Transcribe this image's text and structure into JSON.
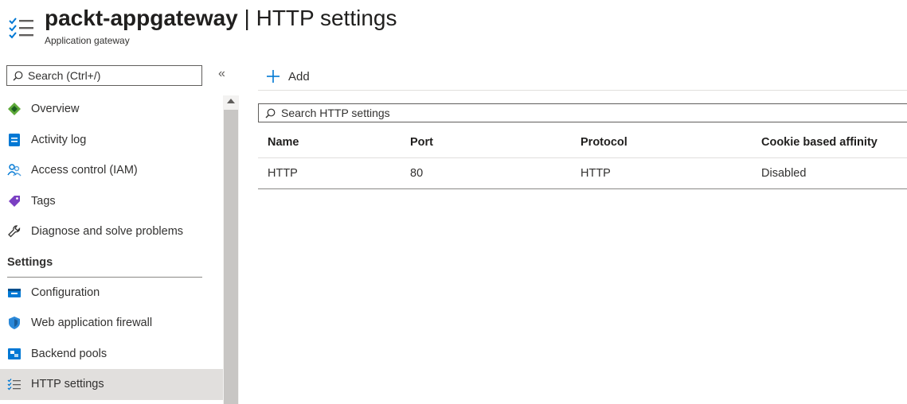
{
  "header": {
    "resource_name": "packt-appgateway",
    "separator": " | ",
    "page_name": "HTTP settings",
    "subtitle": "Application gateway",
    "icon": "http-settings-icon"
  },
  "sidebar": {
    "search_placeholder": "Search (Ctrl+/)",
    "collapse_label": "«",
    "items_top": [
      {
        "label": "Overview",
        "icon": "overview-icon"
      },
      {
        "label": "Activity log",
        "icon": "activity-log-icon"
      },
      {
        "label": "Access control (IAM)",
        "icon": "iam-icon"
      },
      {
        "label": "Tags",
        "icon": "tag-icon"
      },
      {
        "label": "Diagnose and solve problems",
        "icon": "wrench-icon"
      }
    ],
    "section_settings": "Settings",
    "items_settings": [
      {
        "label": "Configuration",
        "icon": "configuration-icon"
      },
      {
        "label": "Web application firewall",
        "icon": "shield-icon"
      },
      {
        "label": "Backend pools",
        "icon": "backend-pools-icon"
      },
      {
        "label": "HTTP settings",
        "icon": "http-settings-icon",
        "selected": true
      }
    ]
  },
  "main": {
    "add_label": "Add",
    "search_placeholder": "Search HTTP settings",
    "table": {
      "columns": [
        "Name",
        "Port",
        "Protocol",
        "Cookie based affinity"
      ],
      "rows": [
        [
          "HTTP",
          "80",
          "HTTP",
          "Disabled"
        ]
      ]
    }
  },
  "colors": {
    "accent": "#0078d4",
    "selected_bg": "#e1dfdd",
    "text": "#323130"
  }
}
